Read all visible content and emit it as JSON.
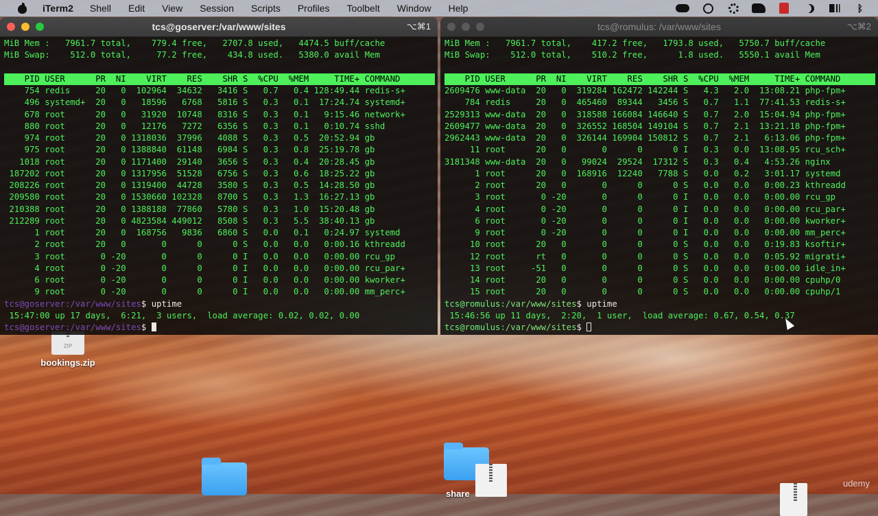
{
  "menubar": {
    "app_name": "iTerm2",
    "items": [
      "Shell",
      "Edit",
      "View",
      "Session",
      "Scripts",
      "Profiles",
      "Toolbelt",
      "Window",
      "Help"
    ]
  },
  "window_left": {
    "title": "tcs@goserver:/var/www/sites",
    "shortcut": "⌥⌘1",
    "lines": [
      "MiB Mem :   7961.7 total,    779.4 free,   2707.8 used,   4474.5 buff/cache",
      "MiB Swap:    512.0 total,     77.2 free,    434.8 used.   5380.0 avail Mem",
      "",
      "    PID USER      PR  NI    VIRT    RES    SHR S  %CPU  %MEM     TIME+ COMMAND",
      "    754 redis     20   0  102964  34632   3416 S   0.7   0.4 128:49.44 redis-s+",
      "    496 systemd+  20   0   18596   6768   5816 S   0.3   0.1  17:24.74 systemd+",
      "    678 root      20   0   31920  10748   8316 S   0.3   0.1   9:15.46 network+",
      "    880 root      20   0   12176   7272   6356 S   0.3   0.1   0:10.74 sshd",
      "    974 root      20   0 1318036  37996   4088 S   0.3   0.5  20:52.94 gb",
      "    975 root      20   0 1388840  61148   6984 S   0.3   0.8  25:19.78 gb",
      "   1018 root      20   0 1171400  29140   3656 S   0.3   0.4  20:28.45 gb",
      " 187202 root      20   0 1317956  51528   6756 S   0.3   0.6  18:25.22 gb",
      " 208226 root      20   0 1319400  44728   3580 S   0.3   0.5  14:28.50 gb",
      " 209580 root      20   0 1530660 102328   8700 S   0.3   1.3  16:27.13 gb",
      " 210388 root      20   0 1388188  77860   5780 S   0.3   1.0  15:20.48 gb",
      " 212289 root      20   0 4823584 449012   8508 S   0.3   5.5  38:40.13 gb",
      "      1 root      20   0  168756   9836   6860 S   0.0   0.1   0:24.97 systemd",
      "      2 root      20   0       0      0      0 S   0.0   0.0   0:00.16 kthreadd",
      "      3 root       0 -20       0      0      0 I   0.0   0.0   0:00.00 rcu_gp",
      "      4 root       0 -20       0      0      0 I   0.0   0.0   0:00.00 rcu_par+",
      "      6 root       0 -20       0      0      0 I   0.0   0.0   0:00.00 kworker+",
      "      9 root       0 -20       0      0      0 I   0.0   0.0   0:00.00 mm_perc+"
    ],
    "prompt1_user": "tcs@goserver",
    "prompt1_path": ":/var/www/sites",
    "prompt1_cmd": "$ uptime",
    "uptime_line": " 15:47:00 up 17 days,  6:21,  3 users,  load average: 0.02, 0.02, 0.00",
    "prompt2_user": "tcs@goserver",
    "prompt2_path": ":/var/www/sites",
    "prompt2_cmd": "$ "
  },
  "window_right": {
    "title": "tcs@romulus: /var/www/sites",
    "shortcut": "⌥⌘2",
    "lines": [
      "MiB Mem :   7961.7 total,    417.2 free,   1793.8 used,   5750.7 buff/cache",
      "MiB Swap:    512.0 total,    510.2 free,      1.8 used.   5550.1 avail Mem",
      "",
      "    PID USER      PR  NI    VIRT    RES    SHR S  %CPU  %MEM     TIME+ COMMAND",
      "2609476 www-data  20   0  319284 162472 142244 S   4.3   2.0  13:08.21 php-fpm+",
      "    784 redis     20   0  465460  89344   3456 S   0.7   1.1  77:41.53 redis-s+",
      "2529313 www-data  20   0  318588 166084 146640 S   0.7   2.0  15:04.94 php-fpm+",
      "2609477 www-data  20   0  326552 168504 149104 S   0.7   2.1  13:21.18 php-fpm+",
      "2962443 www-data  20   0  326144 169904 150812 S   0.7   2.1   6:13.06 php-fpm+",
      "     11 root      20   0       0      0      0 I   0.3   0.0  13:08.95 rcu_sch+",
      "3181348 www-data  20   0   99024  29524  17312 S   0.3   0.4   4:53.26 nginx",
      "      1 root      20   0  168916  12240   7788 S   0.0   0.2   3:01.17 systemd",
      "      2 root      20   0       0      0      0 S   0.0   0.0   0:00.23 kthreadd",
      "      3 root       0 -20       0      0      0 I   0.0   0.0   0:00.00 rcu_gp",
      "      4 root       0 -20       0      0      0 I   0.0   0.0   0:00.00 rcu_par+",
      "      6 root       0 -20       0      0      0 I   0.0   0.0   0:00.00 kworker+",
      "      9 root       0 -20       0      0      0 I   0.0   0.0   0:00.00 mm_perc+",
      "     10 root      20   0       0      0      0 S   0.0   0.0   0:19.83 ksoftir+",
      "     12 root      rt   0       0      0      0 S   0.0   0.0   0:05.92 migrati+",
      "     13 root     -51   0       0      0      0 S   0.0   0.0   0:00.00 idle_in+",
      "     14 root      20   0       0      0      0 S   0.0   0.0   0:00.00 cpuhp/0",
      "     15 root      20   0       0      0      0 S   0.0   0.0   0:00.00 cpuhp/1"
    ],
    "prompt1_user": "tcs@romulus",
    "prompt1_path": ":/var/www/sites",
    "prompt1_cmd": "$ uptime",
    "uptime_line": " 15:46:56 up 11 days,  2:20,  1 user,  load average: 0.67, 0.54, 0.37",
    "prompt2_user": "tcs@romulus",
    "prompt2_path": ":/var/www/sites",
    "prompt2_cmd": "$ "
  },
  "desktop": {
    "zip_file_label": "bookings.zip",
    "zip_icon_text": "ZIP",
    "folder_label_partial": "share",
    "watermark": "udemy"
  }
}
